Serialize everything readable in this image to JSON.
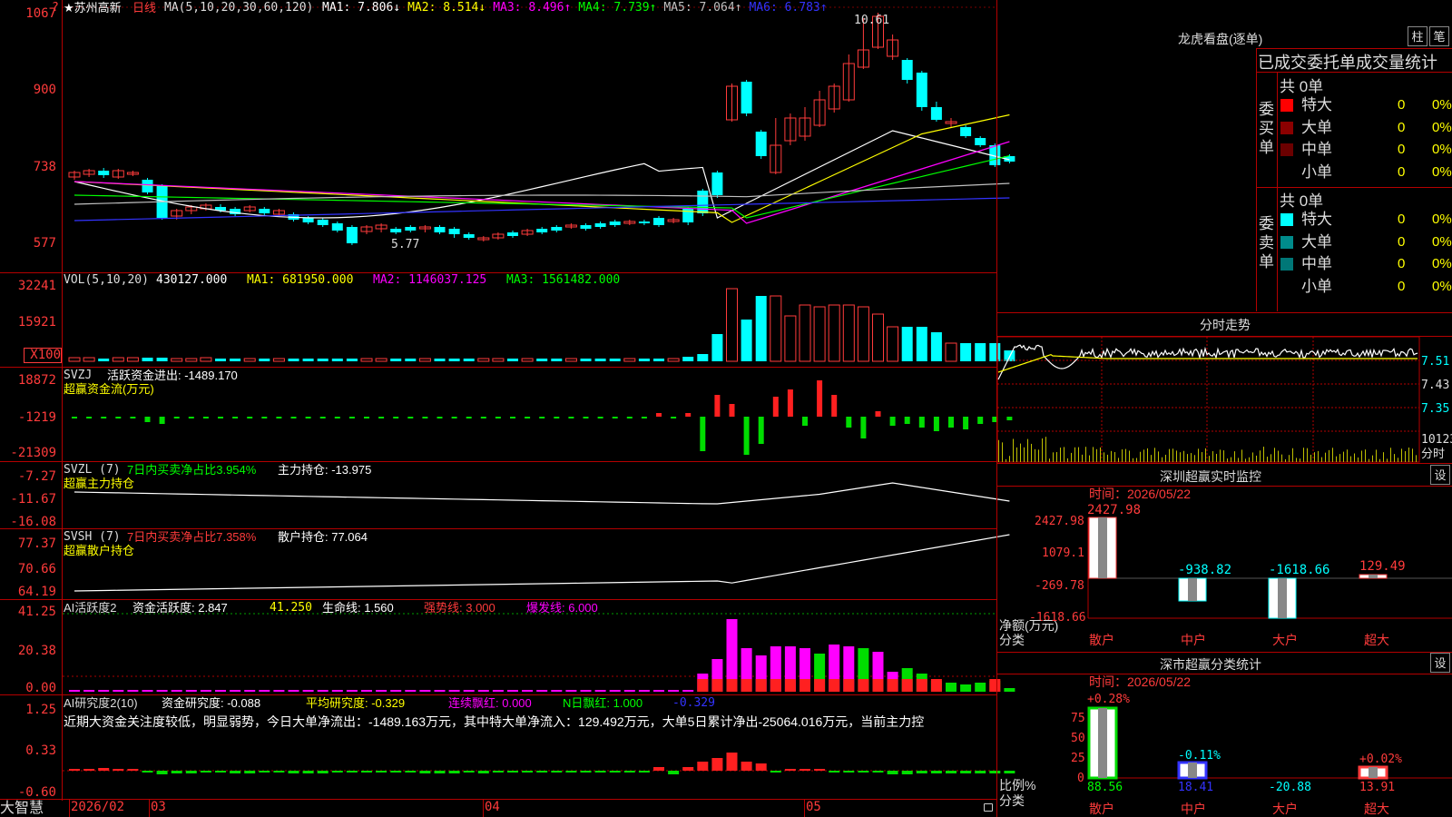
{
  "window": {
    "brand": "大智慧",
    "lock_icon": "lock-icon"
  },
  "header": {
    "stock": "★苏州高新",
    "period": "日线",
    "ma_text": "MA(5,10,20,30,60,120)",
    "ma_values": [
      {
        "label": "MA1: 7.806",
        "arrow": "↓",
        "color": "#ffffff"
      },
      {
        "label": "MA2: 8.514",
        "arrow": "↓",
        "color": "#ffff00"
      },
      {
        "label": "MA3: 8.496",
        "arrow": "↑",
        "color": "#ff00ff"
      },
      {
        "label": "MA4: 7.739",
        "arrow": "↑",
        "color": "#00ff00"
      },
      {
        "label": "MA5: 7.064",
        "arrow": "↑",
        "color": "#c0c0c0"
      },
      {
        "label": "MA6: 6.783",
        "arrow": "↑",
        "color": "#3333ff"
      }
    ],
    "question_icon": "?"
  },
  "price_panel": {
    "y_labels": [
      "1067",
      "900",
      "738",
      "577"
    ],
    "high_label": "10.61",
    "low_label": "5.77"
  },
  "vol_panel": {
    "title": "VOL(5,10,20)",
    "value": "430127.000",
    "ma1": "MA1: 681950.000",
    "ma2": "MA2: 1146037.125",
    "ma3": "MA3: 1561482.000",
    "y_labels": [
      "32241",
      "15921",
      "X100"
    ]
  },
  "svzj_panel": {
    "title": "SVZJ",
    "label": "活跃资金进出: -1489.170",
    "sub": "超赢资金流(万元)",
    "y_labels": [
      "18872",
      "-1219",
      "-21309"
    ]
  },
  "svzl_panel": {
    "title": "SVZL (7)",
    "seven_day": "7日内买卖净占比3.954%",
    "hold": "主力持仓: -13.975",
    "sub": "超赢主力持仓",
    "y_labels": [
      "-7.27",
      "-11.67",
      "-16.08"
    ]
  },
  "svsh_panel": {
    "title": "SVSH (7)",
    "seven_day": "7日内买卖净占比7.358%",
    "hold": "散户持仓: 77.064",
    "sub": "超赢散户持仓",
    "y_labels": [
      "77.37",
      "70.66",
      "64.19"
    ]
  },
  "ai_active_panel": {
    "title": "AI活跃度2",
    "active": "资金活跃度: 2.847",
    "v2": "41.250",
    "life": "生命线: 1.560",
    "strong": "强势线: 3.000",
    "burst": "爆发线: 6.000",
    "y_labels": [
      "41.25",
      "20.38",
      "0.00"
    ]
  },
  "ai_research_panel": {
    "title": "AI研究度2(10)",
    "research": "资金研究度: -0.088",
    "avg": "平均研究度: -0.329",
    "red": "连续飘红: 0.000",
    "nred": "N日飘红: 1.000",
    "last": "-0.329",
    "comment": "近期大资金关注度较低，明显弱势，今日大单净流出：-1489.163万元，其中特大单净流入：129.492万元，大单5日累计净出-25064.016万元，当前主力控",
    "y_labels": [
      "1.25",
      "0.33",
      "-0.60"
    ]
  },
  "x_axis": {
    "labels": [
      "2026/02",
      "03",
      "04",
      "05"
    ]
  },
  "dragon_tiger": {
    "title": "龙虎看盘(逐单)",
    "btn1": "柱",
    "btn2": "笔",
    "tabs": "已成交委托单成交量统计",
    "buy_label": "委买单",
    "sell_label": "委卖单",
    "buy_total": "共 0单",
    "sell_total": "共 0单",
    "buy_rows": [
      {
        "name": "特大",
        "count": "0",
        "pct": "0%",
        "color": "#ff0000"
      },
      {
        "name": "大单",
        "count": "0",
        "pct": "0%",
        "color": "#8b0000"
      },
      {
        "name": "中单",
        "count": "0",
        "pct": "0%",
        "color": "#6b0000"
      },
      {
        "name": "小单",
        "count": "0",
        "pct": "0%",
        "color": ""
      }
    ],
    "sell_rows": [
      {
        "name": "特大",
        "count": "0",
        "pct": "0%",
        "color": "#00ffff"
      },
      {
        "name": "大单",
        "count": "0",
        "pct": "0%",
        "color": "#008b8b"
      },
      {
        "name": "中单",
        "count": "0",
        "pct": "0%",
        "color": "#007777"
      },
      {
        "name": "小单",
        "count": "0",
        "pct": "0%",
        "color": ""
      }
    ]
  },
  "intraday": {
    "title": "分时走势",
    "y_labels": [
      "7.51",
      "7.43",
      "7.35"
    ],
    "vol_label": "10123",
    "vol_unit": "分时"
  },
  "sz_monitor": {
    "title": "深圳超赢实时监控",
    "settings": "设",
    "time_label": "时间：2026/05/22",
    "y_labels": [
      "2427.98",
      "1079.1",
      "-269.78",
      "-1618.66"
    ],
    "y_unit": "净额(万元)",
    "x_unit": "分类",
    "categories": [
      "散户",
      "中户",
      "大户",
      "超大"
    ],
    "values": [
      "2427.98",
      "-938.82",
      "-1618.66",
      "129.49"
    ],
    "value_colors": [
      "#ff3b3b",
      "#00ffff",
      "#00ffff",
      "#ff3b3b"
    ]
  },
  "sz_classify": {
    "title": "深市超赢分类统计",
    "settings": "设",
    "time_label": "时间：2026/05/22",
    "y_labels": [
      "75",
      "50",
      "25",
      "0"
    ],
    "y_unit": "比例%",
    "x_unit": "分类",
    "categories": [
      "散户",
      "中户",
      "大户",
      "超大"
    ],
    "top_values": [
      "+0.28%",
      "-0.11%",
      "",
      "+0.02%"
    ],
    "bottom_values": [
      "88.56",
      "18.41",
      "-20.88",
      "13.91"
    ]
  },
  "chart_data": {
    "type": "candlestick",
    "x_labels": [
      "2026/02",
      "03",
      "04",
      "05"
    ],
    "ylim": [
      5.77,
      10.67
    ],
    "high": 10.61,
    "low": 5.77
  }
}
